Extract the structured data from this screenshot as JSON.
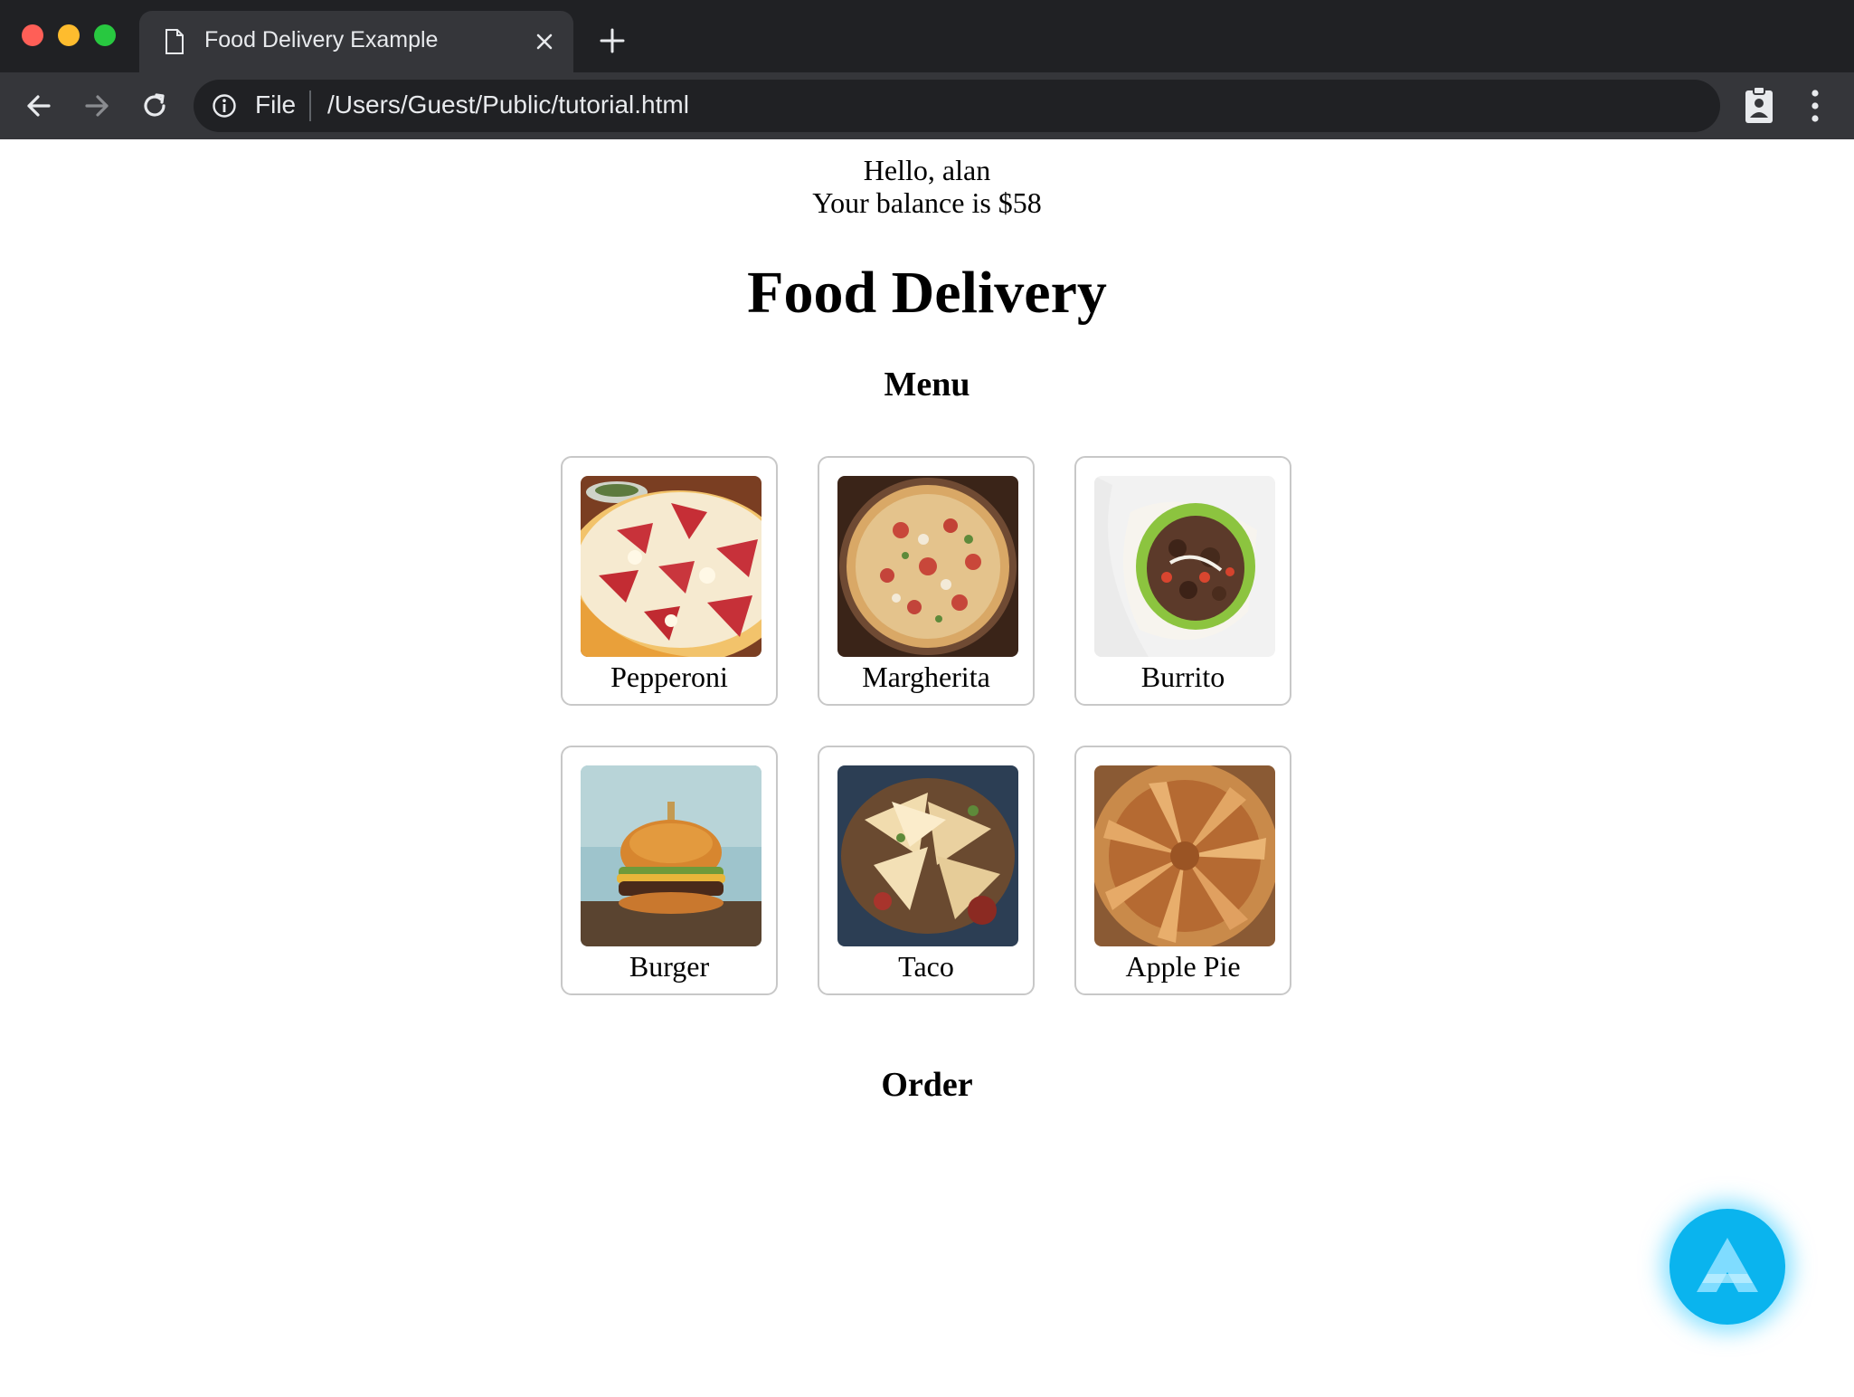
{
  "browser": {
    "tab_title": "Food Delivery Example",
    "scheme_label": "File",
    "url": "/Users/Guest/Public/tutorial.html"
  },
  "user": {
    "greeting": "Hello, alan",
    "balance_text": "Your balance is $58"
  },
  "page": {
    "title": "Food Delivery",
    "menu_heading": "Menu",
    "order_heading": "Order"
  },
  "menu_items": [
    {
      "name": "Pepperoni",
      "image": "pepperoni-pizza-photo"
    },
    {
      "name": "Margherita",
      "image": "margherita-pizza-photo"
    },
    {
      "name": "Burrito",
      "image": "burrito-photo"
    },
    {
      "name": "Burger",
      "image": "burger-photo"
    },
    {
      "name": "Taco",
      "image": "taco-photo"
    },
    {
      "name": "Apple Pie",
      "image": "apple-pie-photo"
    }
  ],
  "colors": {
    "chrome_dark": "#202124",
    "chrome_toolbar": "#35363a",
    "fab_blue": "#0ab4ee"
  }
}
